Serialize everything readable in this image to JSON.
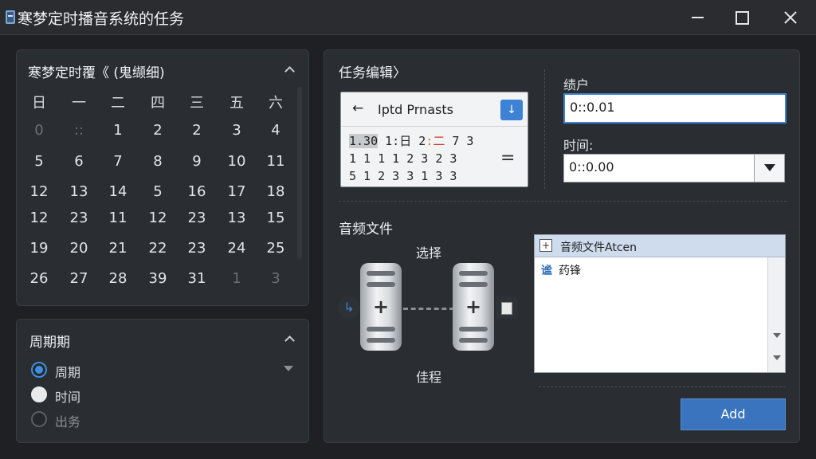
{
  "window": {
    "title": "寒梦定时播音系统的任务"
  },
  "calendar": {
    "title": "寒梦定时覆《 (鬼缬细)",
    "weekdays": [
      "日",
      "一",
      "二",
      "四",
      "三",
      "五",
      "六"
    ],
    "rows": [
      [
        "0",
        "::",
        "1",
        "2",
        "2",
        "3",
        "4"
      ],
      [
        "5",
        "6",
        "7",
        "8",
        "9",
        "10",
        "11"
      ],
      [
        "12",
        "13",
        "14",
        "5",
        "16",
        "17",
        "18"
      ],
      [
        "12",
        "23",
        "11",
        "12",
        "23",
        "13",
        "15"
      ],
      [
        "19",
        "20",
        "21",
        "22",
        "23",
        "24",
        "25"
      ],
      [
        "26",
        "27",
        "28",
        "39",
        "31",
        "1",
        "3"
      ]
    ]
  },
  "period": {
    "title": "周期期",
    "options": [
      {
        "label": "周期",
        "state": "checked"
      },
      {
        "label": "时间",
        "state": "light"
      },
      {
        "label": "出务",
        "state": "off"
      }
    ]
  },
  "task": {
    "title": "任务编辑〉",
    "mini_calendar": {
      "back": "←",
      "title": "Iptd Prnasts",
      "go_icon": "↓",
      "row1": {
        "a": "1.30",
        "b": "1:日",
        "c1": "2",
        "c2": ":",
        "c3": "二",
        "d": "7",
        "e": "3"
      },
      "row2": "1 1 1 1 2 3 2 3",
      "row3": "5 1 2 3 3 1 3 3",
      "eq": "="
    },
    "user_label": "绩户",
    "user_value": "0::0.01",
    "time_label": "时间:",
    "time_value": "0::0.00"
  },
  "audio": {
    "title": "音频文件",
    "select_label": "选择",
    "bottom_label": "佳程",
    "left_icon": "↳",
    "file_list": {
      "header": "音频文件Atcen",
      "header_icon": "+",
      "items": [
        {
          "icon": "谧",
          "label": "药锋"
        }
      ]
    }
  },
  "add_button": "Add"
}
